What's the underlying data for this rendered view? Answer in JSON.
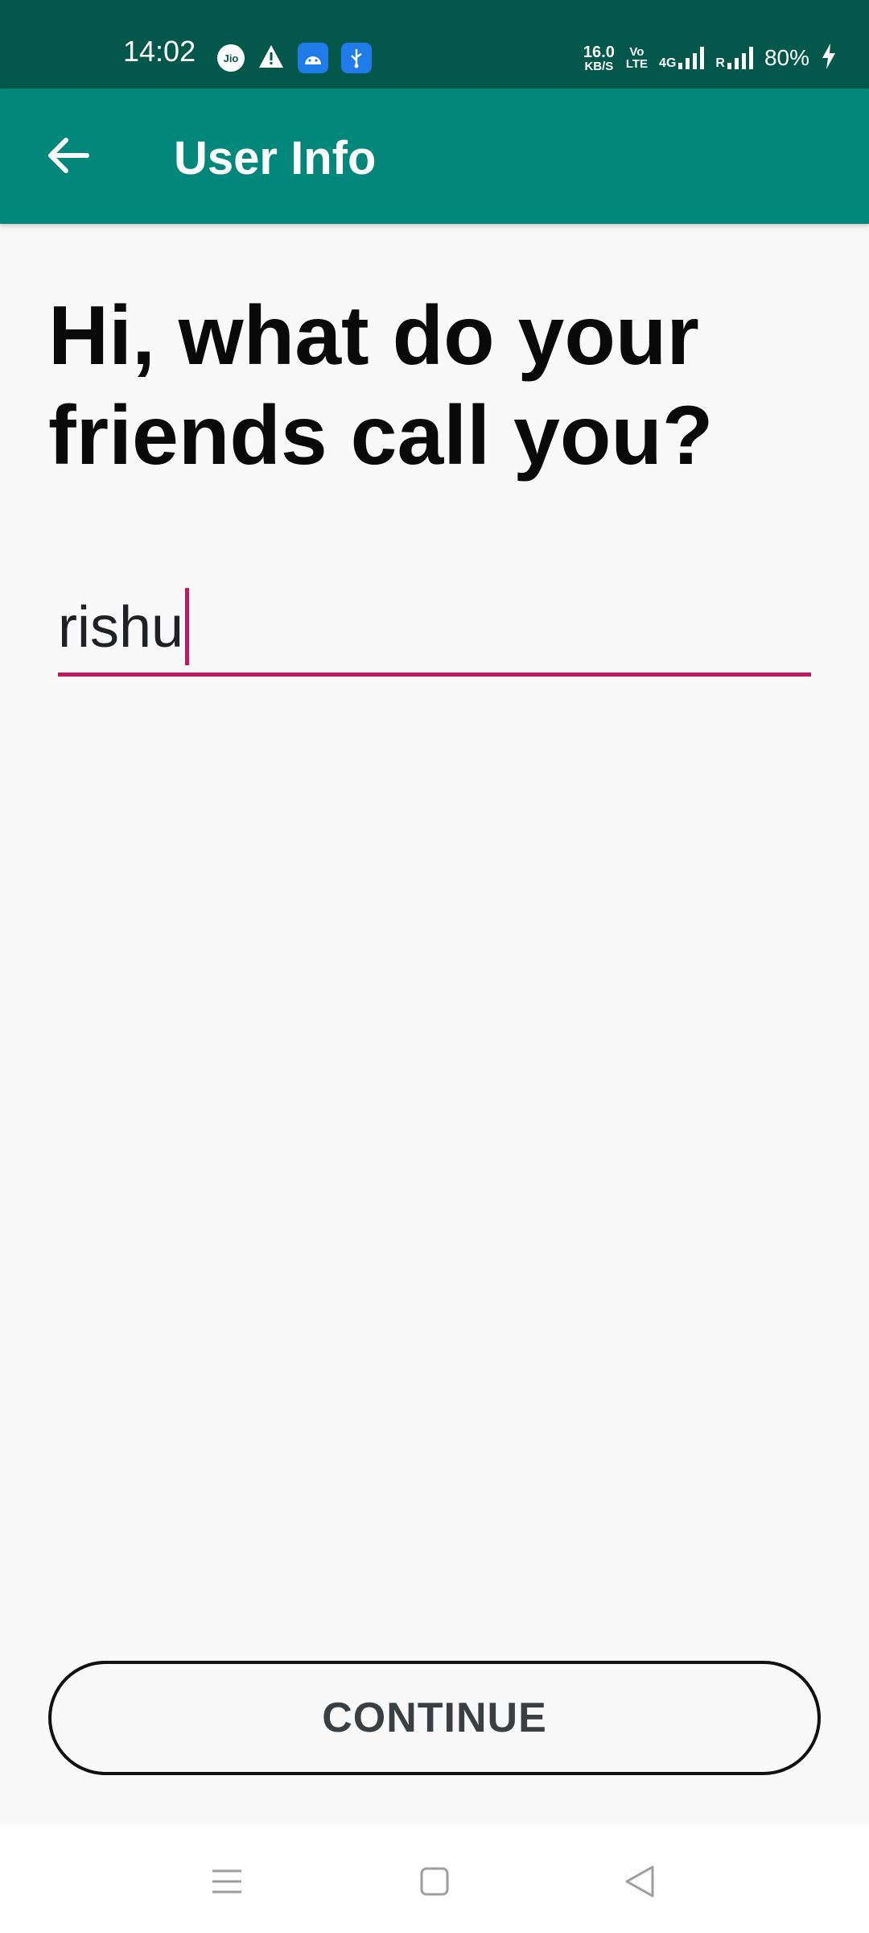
{
  "status_bar": {
    "time": "14:02",
    "carrier_badge": "Jio",
    "net_speed_value": "16.0",
    "net_speed_unit": "KB/S",
    "volte_top": "Vo",
    "volte_bottom": "LTE",
    "network_type": "4G",
    "roaming": "R",
    "battery": "80%"
  },
  "app_bar": {
    "title": "User Info",
    "back_icon": "arrow-left-icon",
    "color": "#02877a"
  },
  "content": {
    "heading_line1": "Hi, what do your",
    "heading_line2": "friends call you?",
    "name_value": "rishu",
    "accent_color": "#c2185b"
  },
  "continue_button": {
    "label": "CONTINUE"
  },
  "nav_bar": {
    "menu_icon": "menu-icon",
    "home_icon": "home-square-icon",
    "back_icon": "back-triangle-icon"
  }
}
